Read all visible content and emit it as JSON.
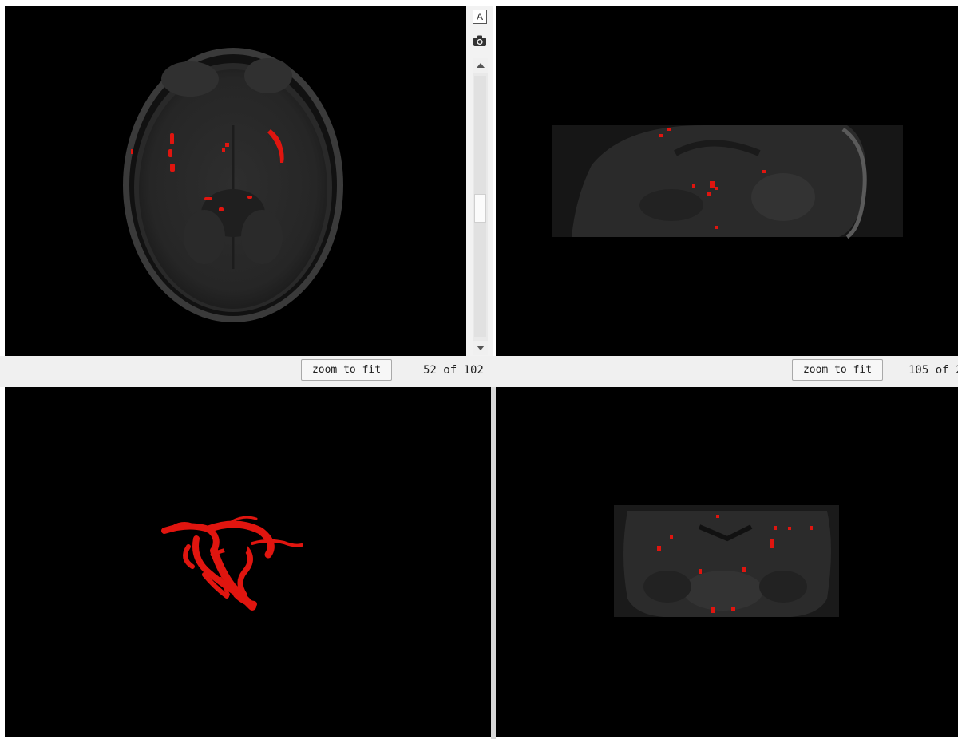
{
  "viewports": {
    "axial": {
      "zoom_label": "zoom to fit",
      "slice_text": "52 of 102"
    },
    "sagittal": {
      "zoom_label": "zoom to fit",
      "slice_text": "105 of 2"
    },
    "render3d": {},
    "coronal": {}
  },
  "toolbar": {
    "text_tool_label": "A",
    "text_tool_icon": "text-annotation-icon",
    "snapshot_icon": "camera-icon"
  },
  "slice_scrollbar": {
    "position_fraction": 0.51
  },
  "colors": {
    "viewport_background": "#000000",
    "segmentation_overlay": "#e0150f",
    "statusbar_background": "#f0f0f0"
  }
}
